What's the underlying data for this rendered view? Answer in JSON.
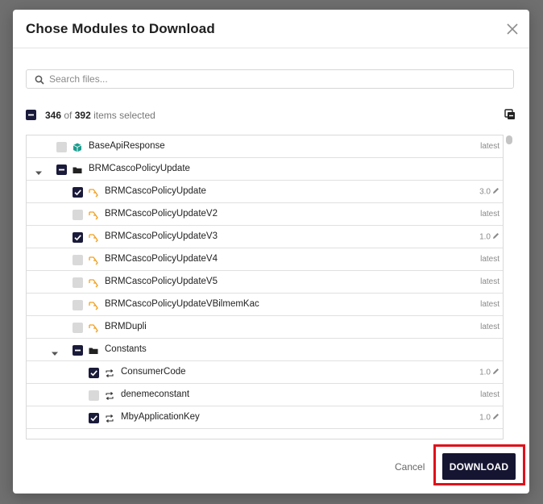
{
  "dialog": {
    "title": "Chose Modules to Download"
  },
  "search": {
    "placeholder": "Search files..."
  },
  "selection": {
    "selected": "346",
    "of_word": "of",
    "total": "392",
    "suffix": "items selected"
  },
  "tree": {
    "rows": [
      {
        "label": "BaseApiResponse",
        "version": "latest"
      },
      {
        "label": "BRMCascoPolicyUpdate",
        "version": ""
      },
      {
        "label": "BRMCascoPolicyUpdate",
        "version": "3.0"
      },
      {
        "label": "BRMCascoPolicyUpdateV2",
        "version": "latest"
      },
      {
        "label": "BRMCascoPolicyUpdateV3",
        "version": "1.0"
      },
      {
        "label": "BRMCascoPolicyUpdateV4",
        "version": "latest"
      },
      {
        "label": "BRMCascoPolicyUpdateV5",
        "version": "latest"
      },
      {
        "label": "BRMCascoPolicyUpdateVBilmemKac",
        "version": "latest"
      },
      {
        "label": "BRMDupli",
        "version": "latest"
      },
      {
        "label": "Constants",
        "version": ""
      },
      {
        "label": "ConsumerCode",
        "version": "1.0"
      },
      {
        "label": "denemeconstant",
        "version": "latest"
      },
      {
        "label": "MbyApplicationKey",
        "version": "1.0"
      }
    ]
  },
  "footer": {
    "cancel_label": "Cancel",
    "download_label": "DOWNLOAD"
  },
  "colors": {
    "primary": "#151532",
    "checkbox_dark": "#1a1a3a",
    "checkbox_empty": "#d9d9d9",
    "rule_icon": "#f0a020",
    "model_icon": "#1a9e8f",
    "highlight": "#e0101a"
  }
}
